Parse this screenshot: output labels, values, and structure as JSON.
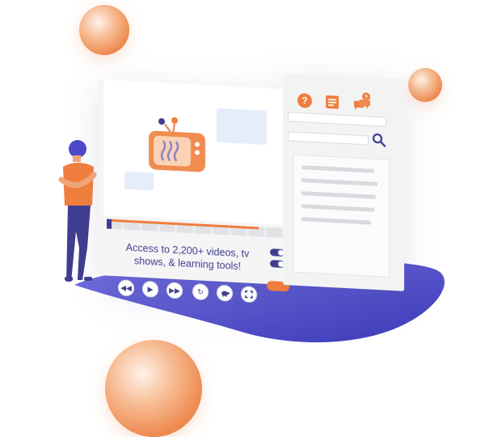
{
  "caption": {
    "text": "Access to 2,200+ videos, tv shows,  & learning tools!"
  },
  "header_icons": {
    "help": "help-icon",
    "notes": "notes-icon",
    "chat": "chat-icon",
    "help_glyph": "?"
  },
  "controls": [
    "rewind-icon",
    "play-icon",
    "fast-forward-icon",
    "loop-icon",
    "turtle-icon",
    "fullscreen-icon"
  ],
  "colors": {
    "accent": "#ef7d3e",
    "primary": "#3f3d8f",
    "blob": "#4b49c9"
  },
  "timeline": {
    "progress": 0.85
  }
}
